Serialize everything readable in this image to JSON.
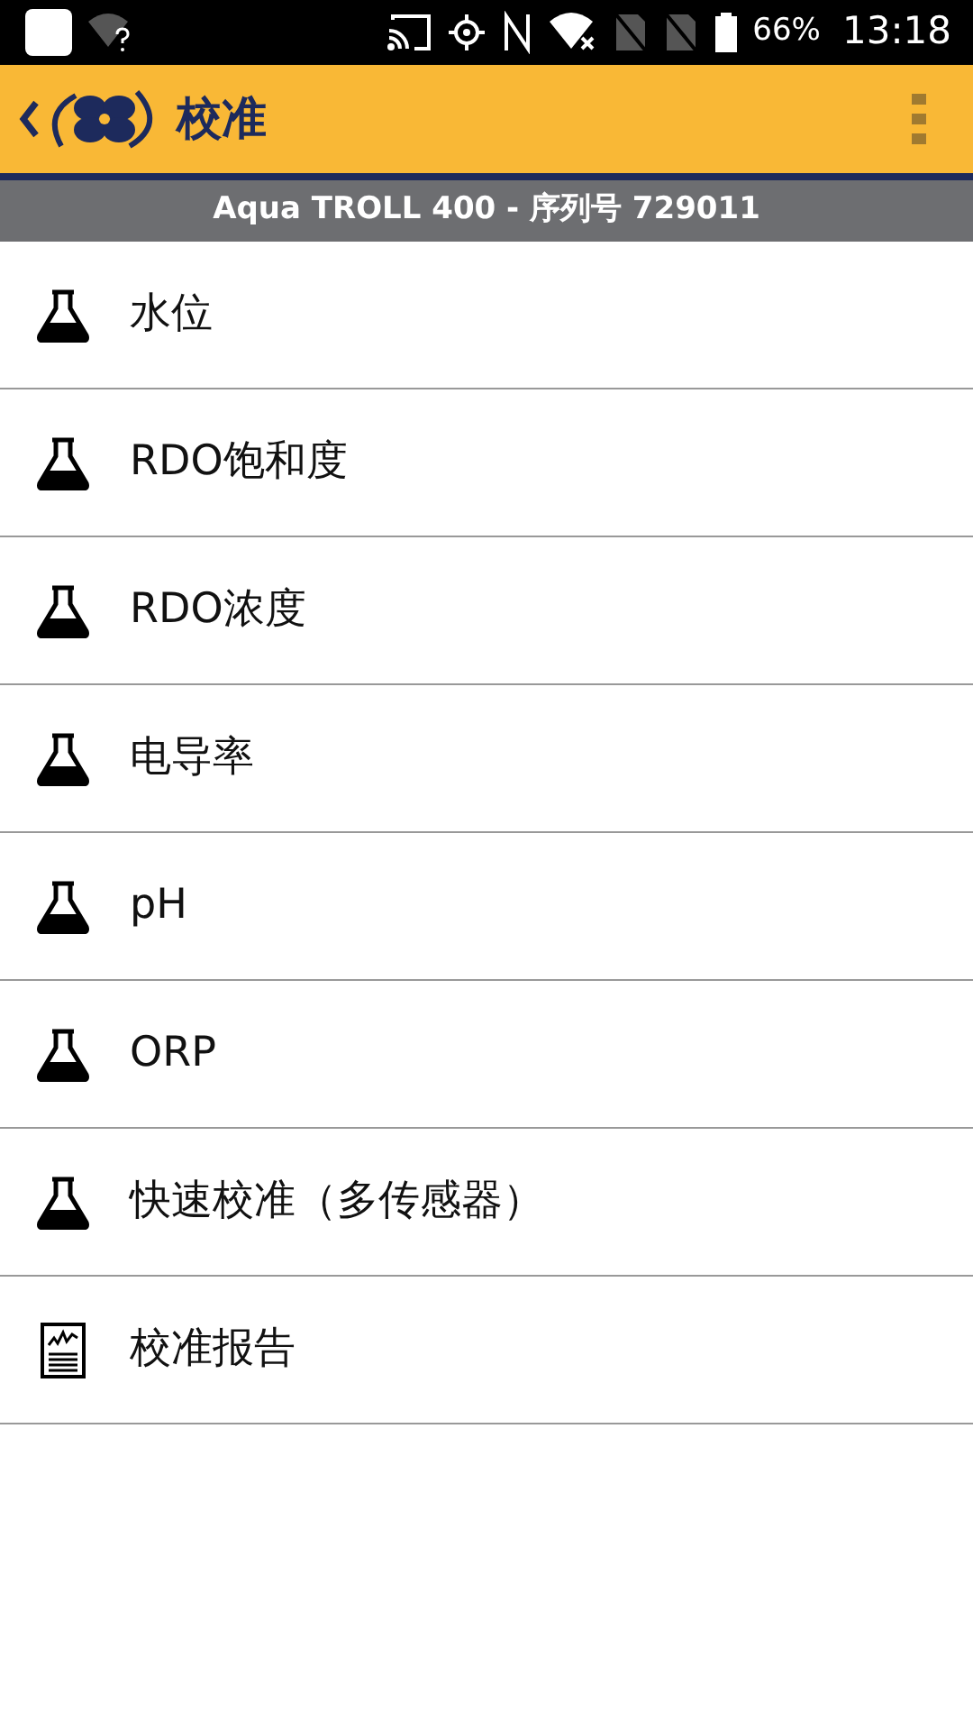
{
  "status_bar": {
    "battery": "66%",
    "time": "13:18"
  },
  "header": {
    "title": "校准"
  },
  "subtitle": "Aqua TROLL 400 - 序列号 729011",
  "items": [
    {
      "kind": "flask",
      "label": "水位"
    },
    {
      "kind": "flask",
      "label": "RDO饱和度"
    },
    {
      "kind": "flask",
      "label": "RDO浓度"
    },
    {
      "kind": "flask",
      "label": "电导率"
    },
    {
      "kind": "flask",
      "label": "pH"
    },
    {
      "kind": "flask",
      "label": "ORP"
    },
    {
      "kind": "flask",
      "label": "快速校准（多传感器）"
    },
    {
      "kind": "report",
      "label": "校准报告"
    }
  ]
}
